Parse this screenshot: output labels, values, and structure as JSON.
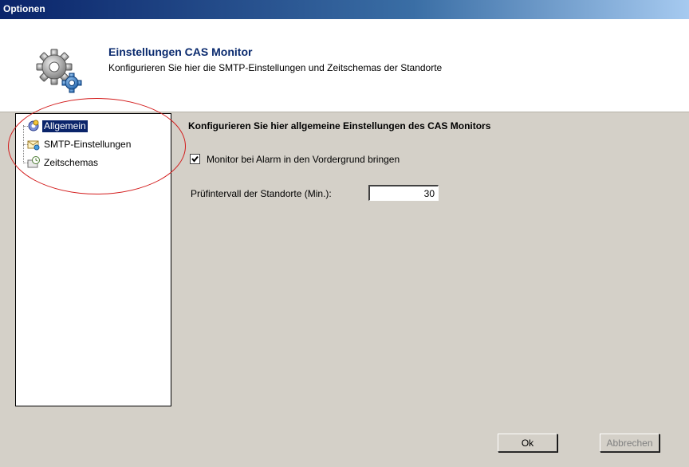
{
  "window": {
    "title": "Optionen"
  },
  "header": {
    "title": "Einstellungen CAS Monitor",
    "subtitle": "Konfigurieren Sie hier die SMTP-Einstellungen und Zeitschemas der Standorte",
    "icon": "gears-icon"
  },
  "sidebar": {
    "items": [
      {
        "label": "Allgemein",
        "icon": "gear-icon",
        "selected": true
      },
      {
        "label": "SMTP-Einstellungen",
        "icon": "envelope-icon",
        "selected": false
      },
      {
        "label": "Zeitschemas",
        "icon": "clock-icon",
        "selected": false
      }
    ]
  },
  "main": {
    "section_title": "Konfigurieren Sie hier allgemeine Einstellungen des CAS Monitors",
    "foreground_checkbox": {
      "label": "Monitor bei Alarm in den Vordergrund bringen",
      "checked": true
    },
    "interval": {
      "label": "Prüfintervall der Standorte (Min.):",
      "value": "30"
    }
  },
  "buttons": {
    "ok": "Ok",
    "cancel": "Abbrechen"
  },
  "colors": {
    "annotation_circle": "#d31b1b",
    "selection": "#0a246a",
    "header_title": "#0a2a6e"
  }
}
